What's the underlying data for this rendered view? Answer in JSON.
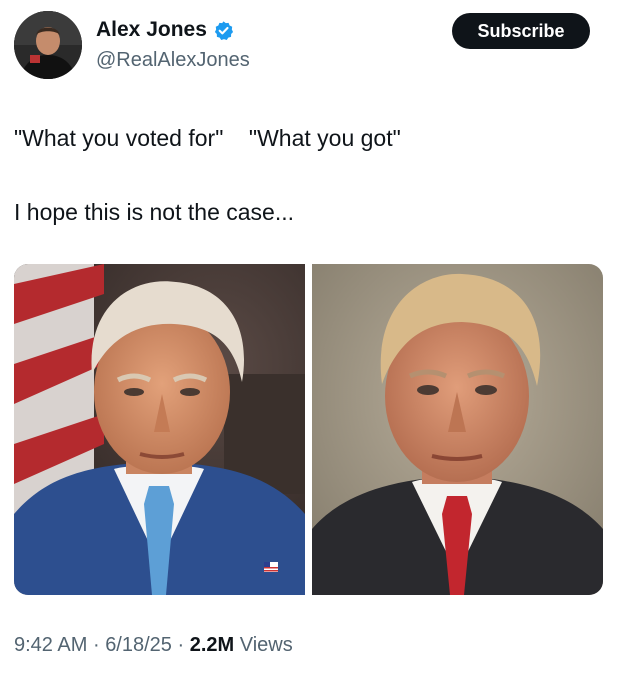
{
  "post": {
    "author": {
      "display_name": "Alex Jones",
      "handle": "@RealAlexJones",
      "verified": true
    },
    "subscribe_label": "Subscribe",
    "text_line_1": "\"What you voted for\"    \"What you got\"",
    "text_line_2": "I hope this is not the case...",
    "media": {
      "left_image": "photo-portrait-left",
      "right_image": "photo-portrait-right"
    },
    "time": "9:42 AM",
    "date": "6/18/25",
    "views_count": "2.2M",
    "views_label": "Views",
    "separator": "·"
  },
  "colors": {
    "text_primary": "#0f1419",
    "text_secondary": "#536471",
    "verified_blue": "#1d9bf0",
    "button_bg": "#0f1419"
  }
}
